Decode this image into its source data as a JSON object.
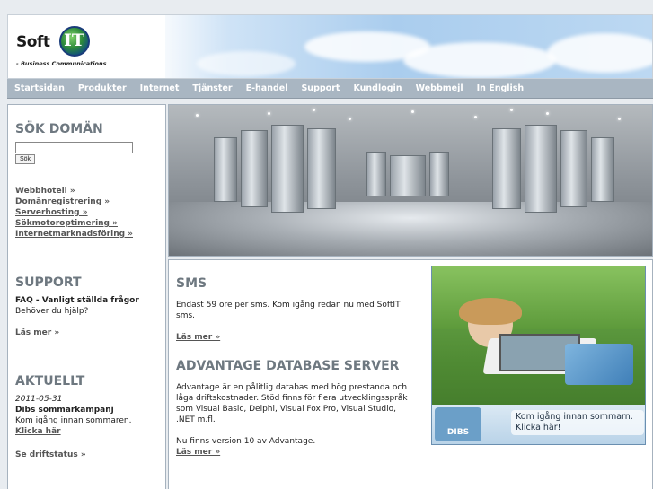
{
  "header": {
    "logo_text": "Soft",
    "logo_it": "IT",
    "tagline": "- Business Communications"
  },
  "nav": {
    "items": [
      "Startsidan",
      "Produkter",
      "Internet",
      "Tjänster",
      "E-handel",
      "Support",
      "Kundlogin",
      "Webbmejl",
      "In English"
    ]
  },
  "domain_search": {
    "heading": "SÖK DOMÄN",
    "input_value": "",
    "button_label": "Sök",
    "links": [
      "Webbhotell »",
      "Domänregistrering »",
      "Serverhosting »",
      "Sökmotoroptimering »",
      "Internetmarknadsföring »"
    ]
  },
  "support": {
    "heading": "SUPPORT",
    "faq_title": "FAQ - Vanligt ställda frågor",
    "faq_text": "Behöver du hjälp?",
    "more": "Läs mer »"
  },
  "news": {
    "heading": "AKTUELLT",
    "date": "2011-05-31",
    "title": "Dibs sommarkampanj",
    "text": "Kom igång innan sommaren.",
    "link": "Klicka här",
    "status_link": "Se driftstatus »"
  },
  "sms": {
    "heading": "SMS",
    "text": "Endast 59 öre per sms. Kom igång redan nu med SoftIT sms.",
    "more": "Läs mer »"
  },
  "ads_server": {
    "heading": "ADVANTAGE DATABASE SERVER",
    "text": "Advantage är en pålitlig databas med hög prestanda och låga driftskostnader. Stöd finns för flera utvecklingsspråk som Visual Basic, Delphi, Visual Fox Pro, Visual Studio, .NET m.fl.",
    "text2": "Nu finns version 10 av Advantage.",
    "more": "Läs mer »"
  },
  "ad": {
    "brand": "DIBS",
    "text": "Kom igång innan sommarn. Klicka här!"
  }
}
